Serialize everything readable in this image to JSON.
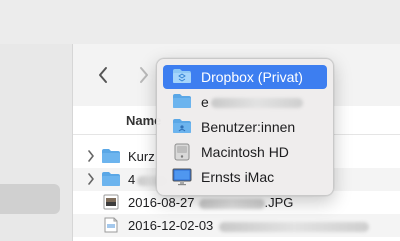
{
  "finder": {
    "column_header": "Name",
    "rows": [
      {
        "label": "Kurz",
        "has_chevron": true,
        "icon": "folder-icon"
      },
      {
        "label": "4",
        "has_chevron": true,
        "icon": "folder-icon"
      },
      {
        "label": "2016-08-27 ...JPG",
        "prefix": "2016-08-27",
        "suffix": ".JPG",
        "has_chevron": false,
        "icon": "image-file-icon"
      },
      {
        "label": "2016-12-02-03",
        "has_chevron": false,
        "icon": "document-file-icon"
      }
    ]
  },
  "path_menu": {
    "items": [
      {
        "label": "Dropbox (Privat)",
        "icon": "dropbox-folder-icon",
        "selected": true
      },
      {
        "label": "e",
        "icon": "folder-icon",
        "selected": false
      },
      {
        "label": "Benutzer:innen",
        "icon": "users-folder-icon",
        "selected": false
      },
      {
        "label": "Macintosh HD",
        "icon": "hard-drive-icon",
        "selected": false
      },
      {
        "label": "Ernsts iMac",
        "icon": "imac-icon",
        "selected": false
      }
    ]
  },
  "colors": {
    "selection": "#3d7ef0",
    "folder": "#5aa7e6",
    "folder_tab": "#3e8fd6"
  }
}
